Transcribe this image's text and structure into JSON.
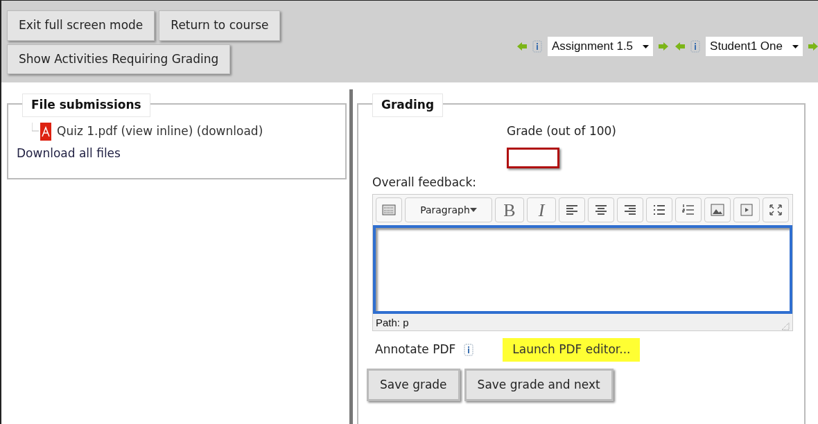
{
  "top_buttons": [
    [
      "Exit full screen mode",
      "Return to course"
    ],
    [
      "Show Activities Requiring Grading"
    ]
  ],
  "navigation": [
    {
      "select": "Assignment 1.5"
    },
    {
      "select": "Student1 One"
    }
  ],
  "file_submissions": {
    "legend": "File submissions",
    "file": "Quiz 1.pdf (view inline) (download)",
    "download_all": "Download all files"
  },
  "grading": {
    "legend": "Grading",
    "grade_label": "Grade (out of 100)",
    "feedback_label": "Overall feedback:",
    "toolbar": [
      {
        "kind": "toggle"
      },
      {
        "kind": "format",
        "label": "Paragraph"
      },
      {
        "kind": "bold",
        "label": "B"
      },
      {
        "kind": "italic",
        "label": "I"
      },
      {
        "kind": "align-left"
      },
      {
        "kind": "align-center"
      },
      {
        "kind": "align-right"
      },
      {
        "kind": "bullets"
      },
      {
        "kind": "numbers"
      },
      {
        "kind": "image"
      },
      {
        "kind": "media"
      },
      {
        "kind": "fullscreen"
      }
    ],
    "path": "Path: p",
    "annotate_label": "Annotate PDF",
    "launch_button": "Launch PDF editor...",
    "buttons": [
      "Save grade",
      "Save grade and next"
    ]
  }
}
